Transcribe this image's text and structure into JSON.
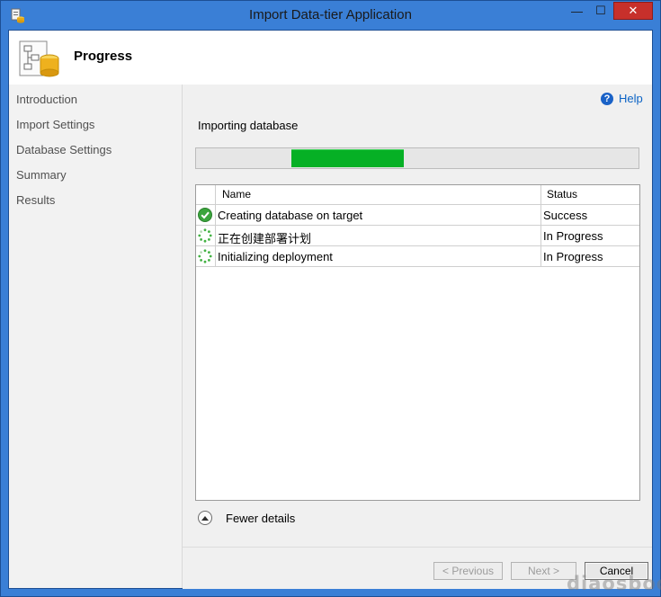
{
  "window": {
    "title": "Import Data-tier Application",
    "minimize_glyph": "—",
    "maximize_glyph": "☐",
    "close_glyph": "✕"
  },
  "header": {
    "title": "Progress"
  },
  "nav": {
    "items": [
      {
        "label": "Introduction"
      },
      {
        "label": "Import Settings"
      },
      {
        "label": "Database Settings"
      },
      {
        "label": "Summary"
      },
      {
        "label": "Results"
      }
    ]
  },
  "main": {
    "help_label": "Help",
    "status_text": "Importing database",
    "progress": {
      "segment_start": 0.215,
      "segment_end": 0.47,
      "color": "#06b025"
    },
    "grid": {
      "columns": [
        "Name",
        "Status"
      ],
      "rows": [
        {
          "name": "Creating database on target",
          "status": "Success",
          "icon": "success-check-icon"
        },
        {
          "name": "正在创建部署计划",
          "status": "In Progress",
          "icon": "in-progress-spinner-icon"
        },
        {
          "name": "Initializing deployment",
          "status": "In Progress",
          "icon": "in-progress-spinner-icon"
        }
      ]
    },
    "details_toggle": "Fewer details"
  },
  "footer": {
    "previous_label": "< Previous",
    "next_label": "Next >",
    "cancel_label": "Cancel"
  },
  "watermark": "diaosbook"
}
